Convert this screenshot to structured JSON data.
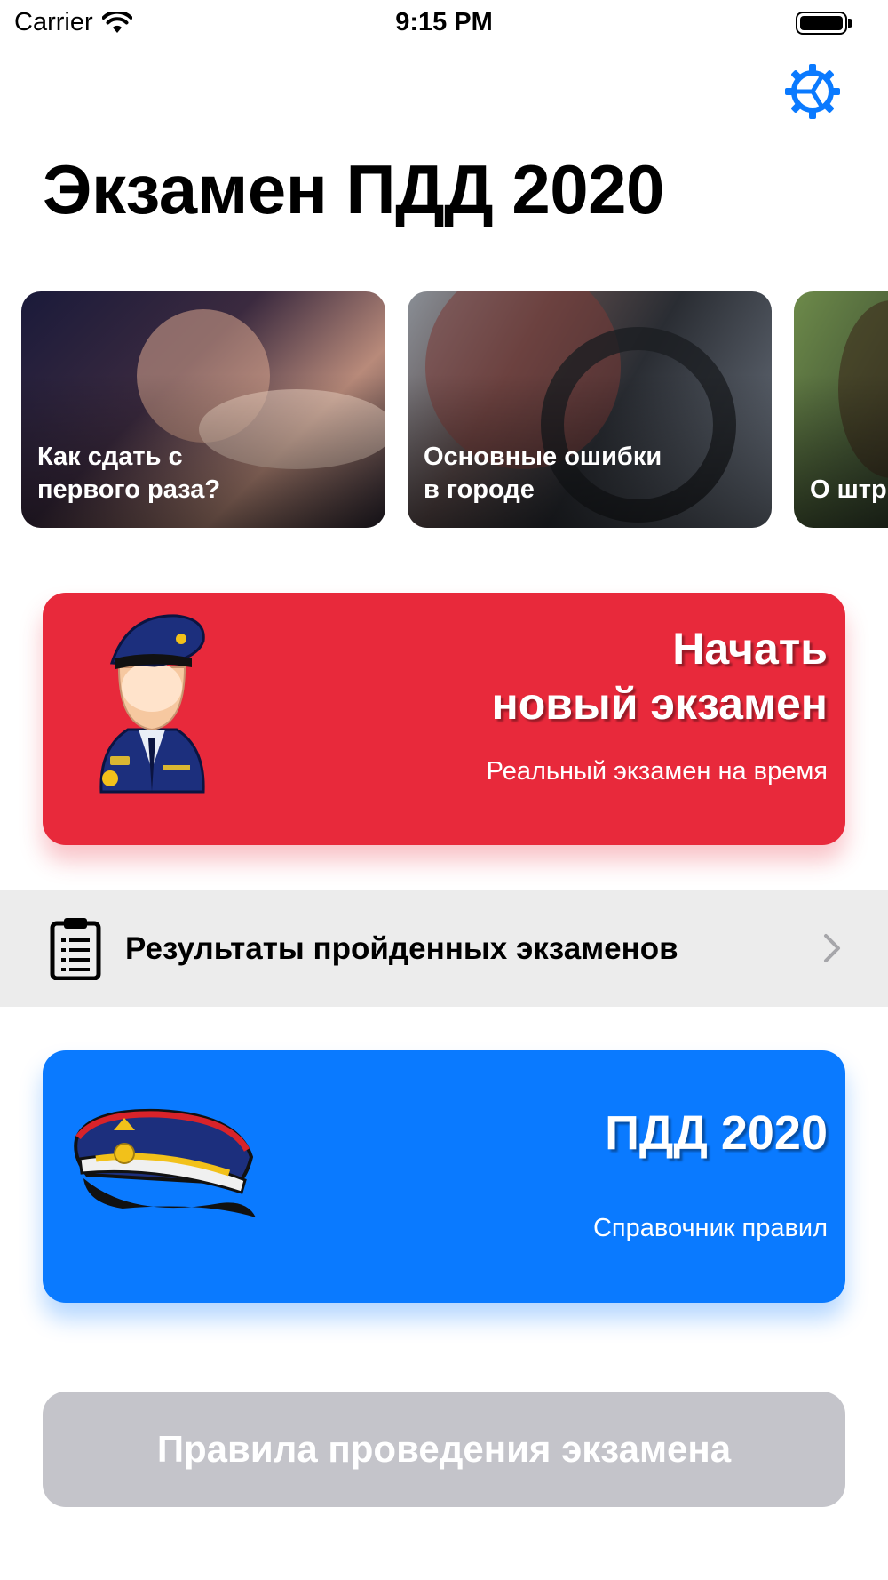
{
  "status_bar": {
    "carrier": "Carrier",
    "time": "9:15 PM"
  },
  "header": {
    "title": "Экзамен ПДД 2020",
    "settings_icon": "gear-icon"
  },
  "articles": [
    {
      "label": "Как сдать с\nпервого раза?"
    },
    {
      "label": "Основные ошибки\nв городе"
    },
    {
      "label": "О штр"
    }
  ],
  "start_exam": {
    "title": "Начать\nновый экзамен",
    "subtitle": "Реальный экзамен на время",
    "icon": "police-officer-icon",
    "color": "#e8293b"
  },
  "results": {
    "label": "Результаты пройденных экзаменов",
    "icon": "clipboard-icon"
  },
  "rules_reference": {
    "title": "ПДД 2020",
    "subtitle": "Справочник правил",
    "icon": "police-cap-icon",
    "color": "#0a7aff"
  },
  "exam_rules_button": {
    "label": "Правила проведения экзамена"
  }
}
